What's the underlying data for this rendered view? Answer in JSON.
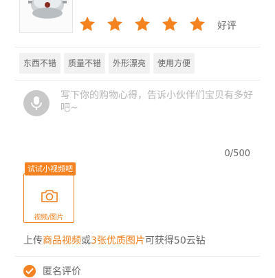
{
  "rating": {
    "value": 5,
    "max": 5,
    "label": "好评",
    "star_color": "#f58220"
  },
  "quick_tags": [
    "东西不错",
    "质量不错",
    "外形漂亮",
    "使用方便"
  ],
  "review": {
    "placeholder": "写下你的购物心得，告诉小伙伴们宝贝有多好吧~",
    "char_count": "0/500"
  },
  "media": {
    "badge": "试试小视频吧",
    "label": "视频/图片",
    "accent": "#f07d1a"
  },
  "reward": {
    "part1": "上传",
    "part2": "商品视频",
    "part3": "或",
    "part4": "3张优质图片",
    "part5": "可获得50云钻"
  },
  "anonymous": {
    "label": "匿名评价",
    "checked": true
  }
}
